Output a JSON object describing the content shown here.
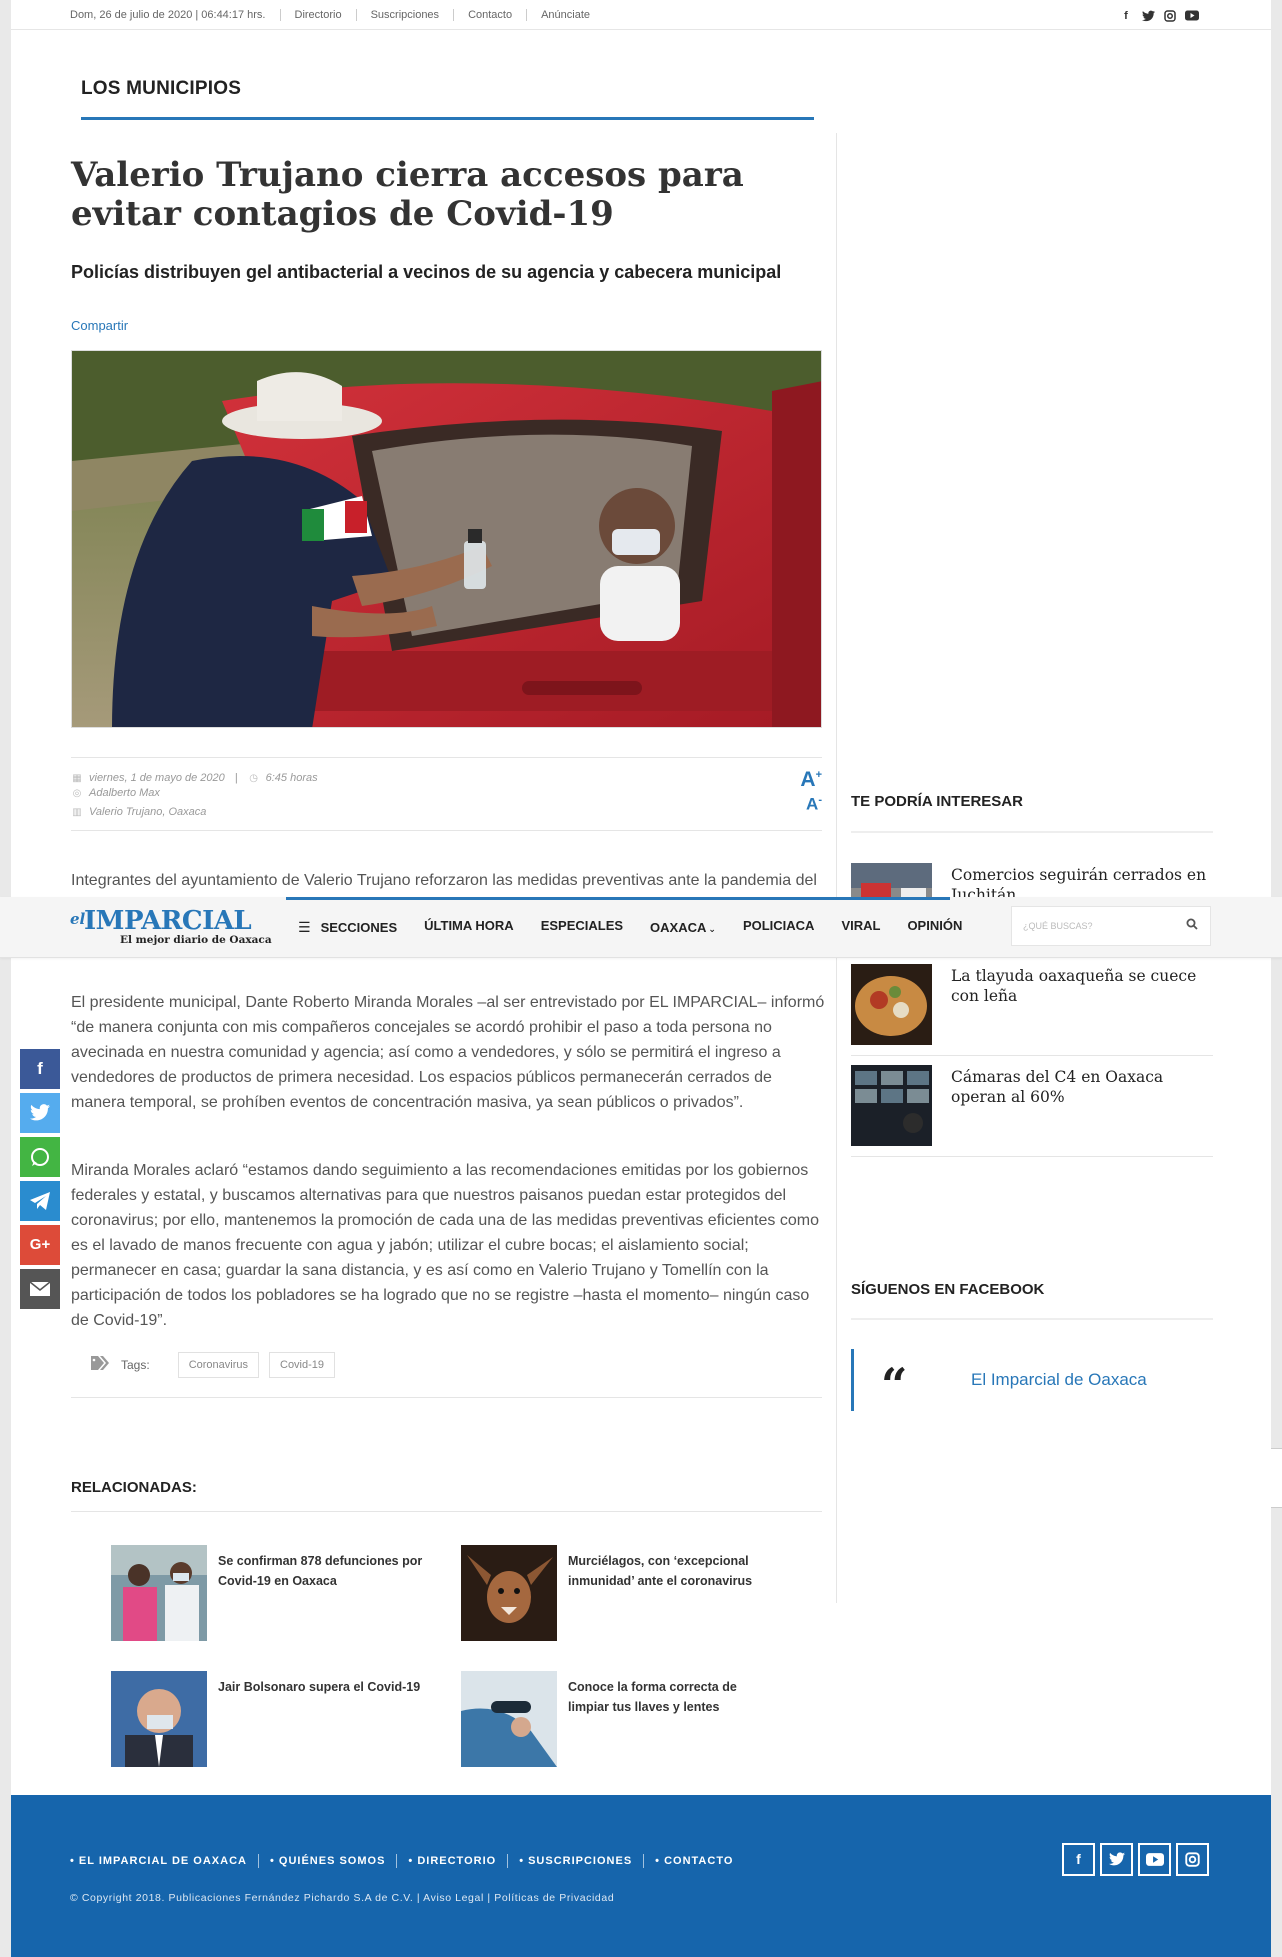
{
  "topbar": {
    "date": "Dom, 26 de julio de 2020 | 06:44:17 hrs.",
    "links": [
      "Directorio",
      "Suscripciones",
      "Contacto",
      "Anúnciate"
    ],
    "social_icons": [
      "facebook-icon",
      "twitter-icon",
      "instagram-icon",
      "youtube-icon"
    ]
  },
  "section": {
    "title": "LOS MUNICIPIOS"
  },
  "article": {
    "title": "Valerio Trujano cierra accesos para evitar contagios de Covid-19",
    "subtitle": "Policías distribuyen gel antibacterial a vecinos de su agencia y cabecera municipal",
    "share_label": "Compartir",
    "date": "viernes, 1 de mayo de 2020",
    "time": "6:45 horas",
    "author": "Adalberto Max",
    "location": "Valerio Trujano, Oaxaca",
    "font_increase": "A",
    "font_decrease": "A",
    "paragraphs": [
      "Integrantes del ayuntamiento de Valerio Trujano reforzaron las medidas preventivas ante la pandemia del coronavirus, por lo que cerraron los accesos a la comunidad como una medida preventiva derivada de la contingencia sanitaria.",
      "El presidente municipal, Dante Roberto Miranda Morales –al ser entrevistado por EL IMPARCIAL– informó “de manera conjunta con mis compañeros concejales se acordó prohibir el paso a toda persona no avecinada en nuestra comunidad y agencia; así como a vendedores, y sólo se permitirá el ingreso a vendedores de productos de primera necesidad. Los espacios públicos permanecerán cerrados de manera temporal, se prohíben eventos de concentración masiva, ya sean públicos o privados”.",
      "Miranda Morales aclaró “estamos dando seguimiento a las recomendaciones emitidas por los gobiernos federales y estatal, y buscamos alternativas para que nuestros paisanos puedan estar protegidos del coronavirus; por ello, mantenemos la promoción de cada una de las medidas preventivas eficientes como es el lavado de manos frecuente con agua y jabón; utilizar el cubre bocas; el aislamiento social; permanecer en casa; guardar la sana distancia, y es así como en Valerio Trujano y Tomellín con la participación de todos los pobladores se ha logrado que no se registre –hasta el momento– ningún caso de Covid-19”."
    ],
    "tags_label": "Tags:",
    "tags": [
      "Coronavirus",
      "Covid-19"
    ]
  },
  "related": {
    "title": "RELACIONADAS:",
    "items": [
      {
        "text": "Se confirman 878 defunciones por Covid-19 en Oaxaca"
      },
      {
        "text": "Murciélagos, con ‘excepcional inmunidad’ ante el coronavirus"
      },
      {
        "text": "Jair Bolsonaro supera el Covid-19"
      },
      {
        "text": "Conoce la forma correcta de limpiar tus llaves y lentes"
      }
    ]
  },
  "sidebar": {
    "interest_title": "TE PODRÍA INTERESAR",
    "interest_items": [
      {
        "text": "Comercios seguirán cerrados en Juchitán"
      },
      {
        "text": "La tlayuda oaxaqueña se cuece con leña"
      },
      {
        "text": "Cámaras del C4 en Oaxaca operan al 60%"
      }
    ],
    "facebook_title": "SÍGUENOS EN FACEBOOK",
    "facebook_quote": "“",
    "facebook_page": "El Imparcial de Oaxaca"
  },
  "navbar": {
    "logo_el": "el",
    "logo_name": "IMPARCIAL",
    "logo_tagline": "El mejor diario de Oaxaca",
    "items": [
      "SECCIONES",
      "ÚLTIMA HORA",
      "ESPECIALES",
      "OAXACA",
      "POLICIACA",
      "VIRAL",
      "OPINIÓN"
    ],
    "search_placeholder": "¿QUÉ BUSCAS?"
  },
  "float_share": [
    "facebook",
    "twitter",
    "whatsapp",
    "telegram",
    "google-plus",
    "email"
  ],
  "footer": {
    "links": [
      "• EL IMPARCIAL DE OAXACA",
      "• QUIÉNES SOMOS",
      "• DIRECTORIO",
      "• SUSCRIPCIONES",
      "• CONTACTO"
    ],
    "copyright": "© Copyright 2018. Publicaciones Fernández Pichardo S.A de C.V. | Aviso Legal | Políticas de Privacidad"
  },
  "colors": {
    "brand_blue": "#2877b8",
    "footer_blue": "#1665ac"
  }
}
